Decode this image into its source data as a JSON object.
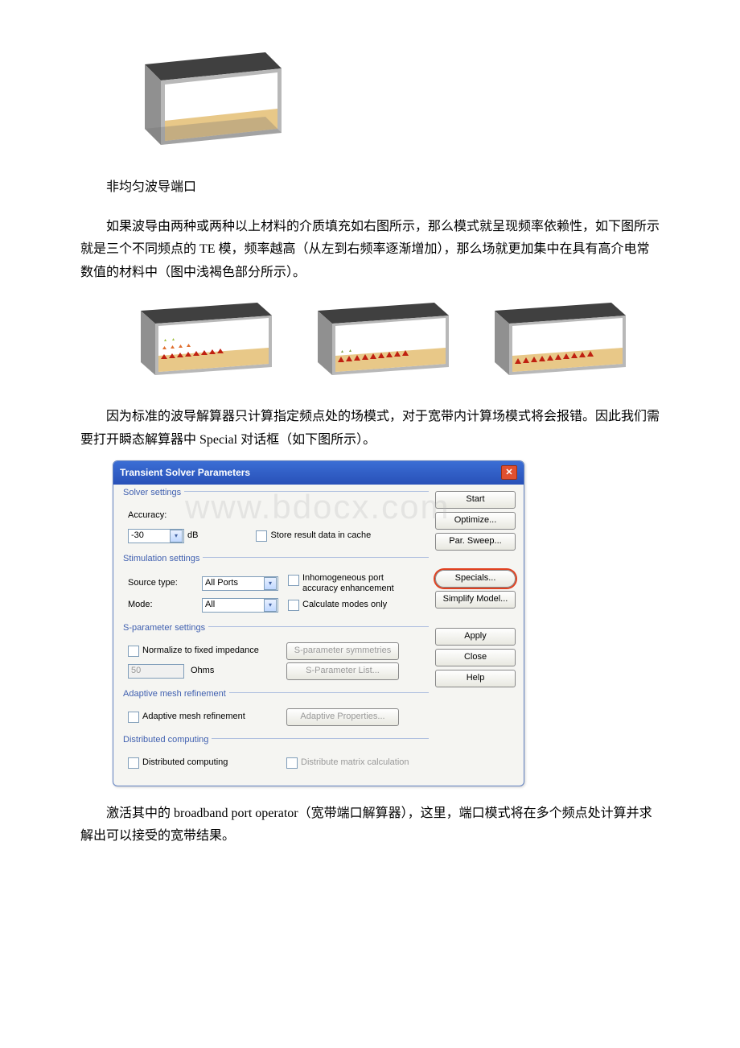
{
  "caption1": "非均匀波导端口",
  "para1": "如果波导由两种或两种以上材料的介质填充如右图所示，那么模式就呈现频率依赖性，如下图所示就是三个不同频点的 TE 模，频率越高（从左到右频率逐渐增加），那么场就更加集中在具有高介电常数值的材料中（图中浅褐色部分所示）。",
  "para2": "因为标准的波导解算器只计算指定频点处的场模式，对于宽带内计算场模式将会报错。因此我们需要打开瞬态解算器中 Special 对话框（如下图所示）。",
  "para3": "激活其中的 broadband port operator（宽带端口解算器），这里，端口模式将在多个频点处计算并求解出可以接受的宽带结果。",
  "watermark": "www.bdocx.com",
  "dialog": {
    "title": "Transient Solver Parameters",
    "group_solver": "Solver settings",
    "accuracy_label": "Accuracy:",
    "accuracy_value": "-30",
    "accuracy_unit": "dB",
    "store_cache": "Store result data in cache",
    "group_stim": "Stimulation settings",
    "source_type_label": "Source type:",
    "source_type_value": "All Ports",
    "inhomo": "Inhomogeneous port accuracy enhancement",
    "mode_label": "Mode:",
    "mode_value": "All",
    "calc_modes": "Calculate modes only",
    "group_sparam": "S-parameter settings",
    "normalize": "Normalize to fixed impedance",
    "impedance_value": "50",
    "impedance_unit": "Ohms",
    "sparam_sym": "S-parameter symmetries",
    "sparam_list": "S-Parameter List...",
    "group_mesh": "Adaptive mesh refinement",
    "adaptive_chk": "Adaptive mesh refinement",
    "adaptive_btn": "Adaptive Properties...",
    "group_dist": "Distributed computing",
    "dist_chk": "Distributed computing",
    "dist_btn": "Distribute matrix calculation",
    "buttons": {
      "start": "Start",
      "optimize": "Optimize...",
      "par_sweep": "Par. Sweep...",
      "specials": "Specials...",
      "simplify": "Simplify Model...",
      "apply": "Apply",
      "close": "Close",
      "help": "Help"
    }
  }
}
